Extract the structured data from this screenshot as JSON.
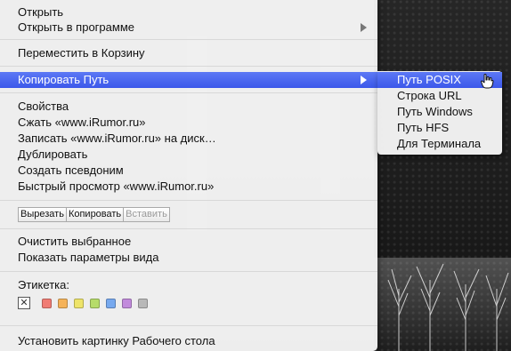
{
  "menu": {
    "group1": [
      "Открыть",
      "Открыть в программе"
    ],
    "group2": [
      "Переместить в Корзину"
    ],
    "copy_path": "Копировать Путь",
    "group4": [
      "Свойства",
      "Сжать «www.iRumor.ru»",
      "Записать «www.iRumor.ru» на диск…",
      "Дублировать",
      "Создать псевдоним",
      "Быстрый просмотр «www.iRumor.ru»"
    ],
    "edit_buttons": [
      "Вырезать",
      "Копировать",
      "Вставить"
    ],
    "group6": [
      "Очистить выбранное",
      "Показать параметры вида"
    ],
    "label_title": "Этикетка:",
    "label_colors": [
      "#f07c74",
      "#f5b35a",
      "#eee46a",
      "#b6dc6a",
      "#77a9ef",
      "#c28bdc",
      "#b8b8b8"
    ],
    "last_item": "Установить картинку Рабочего стола"
  },
  "submenu": {
    "items": [
      "Путь POSIX",
      "Строка URL",
      "Путь Windows",
      "Путь HFS",
      "Для Терминала"
    ]
  },
  "colors": {
    "highlight": "#3b57ea"
  }
}
